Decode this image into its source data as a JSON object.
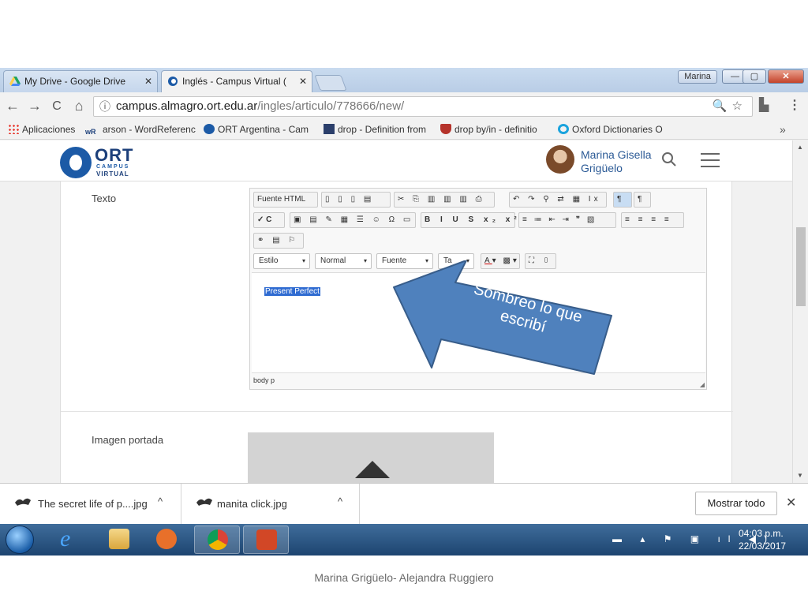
{
  "browser": {
    "tabs": [
      {
        "title": "My Drive - Google Drive",
        "close": "✕"
      },
      {
        "title": "Inglés - Campus Virtual (",
        "close": "✕"
      }
    ],
    "profile": "Marina",
    "window_buttons": {
      "minimize": "—",
      "maximize": "▢",
      "close": "✕"
    },
    "url_host": "campus.almagro.ort.edu.ar",
    "url_path": "/ingles/articulo/778666/new/",
    "nav": {
      "back": "←",
      "forward": "→",
      "reload": "C",
      "home": "⌂",
      "info": "ⓘ",
      "zoom_star": "🔍☆",
      "menu": "⋮"
    },
    "bookmarks": [
      "Aplicaciones",
      "arson - WordReferenc",
      "ORT Argentina - Cam",
      "drop - Definition from",
      "drop by/in - definitio",
      "Oxford Dictionaries O"
    ],
    "bookmarks_more": "»"
  },
  "site": {
    "logo": {
      "ort": "ORT",
      "campus": "CAMPUS",
      "virtual": "VIRTUAL"
    },
    "user_first": "Marina Gisella",
    "user_last": "Grigüelo",
    "search_icon": "⚲"
  },
  "form": {
    "label_texto": "Texto",
    "label_imagen": "Imagen portada",
    "editor": {
      "row1": [
        "Fuente HTML"
      ],
      "combos": [
        "Estilo",
        "Normal",
        "Fuente",
        "Ta"
      ],
      "content": "Present Perfect",
      "path": "body  p",
      "caret": "▾"
    }
  },
  "annotation": {
    "text": "Sombreo lo que escribí",
    "color": "#4f81bd"
  },
  "downloads": [
    {
      "name": "The secret life of p....jpg",
      "chevron": "^"
    },
    {
      "name": "manita click.jpg",
      "chevron": "^"
    }
  ],
  "downloads_show_all": "Mostrar todo",
  "downloads_close": "✕",
  "taskbar": {
    "time": "04:03 p.m.",
    "date": "22/03/2017"
  },
  "footer": "Marina Grigüelo- Alejandra Ruggiero"
}
